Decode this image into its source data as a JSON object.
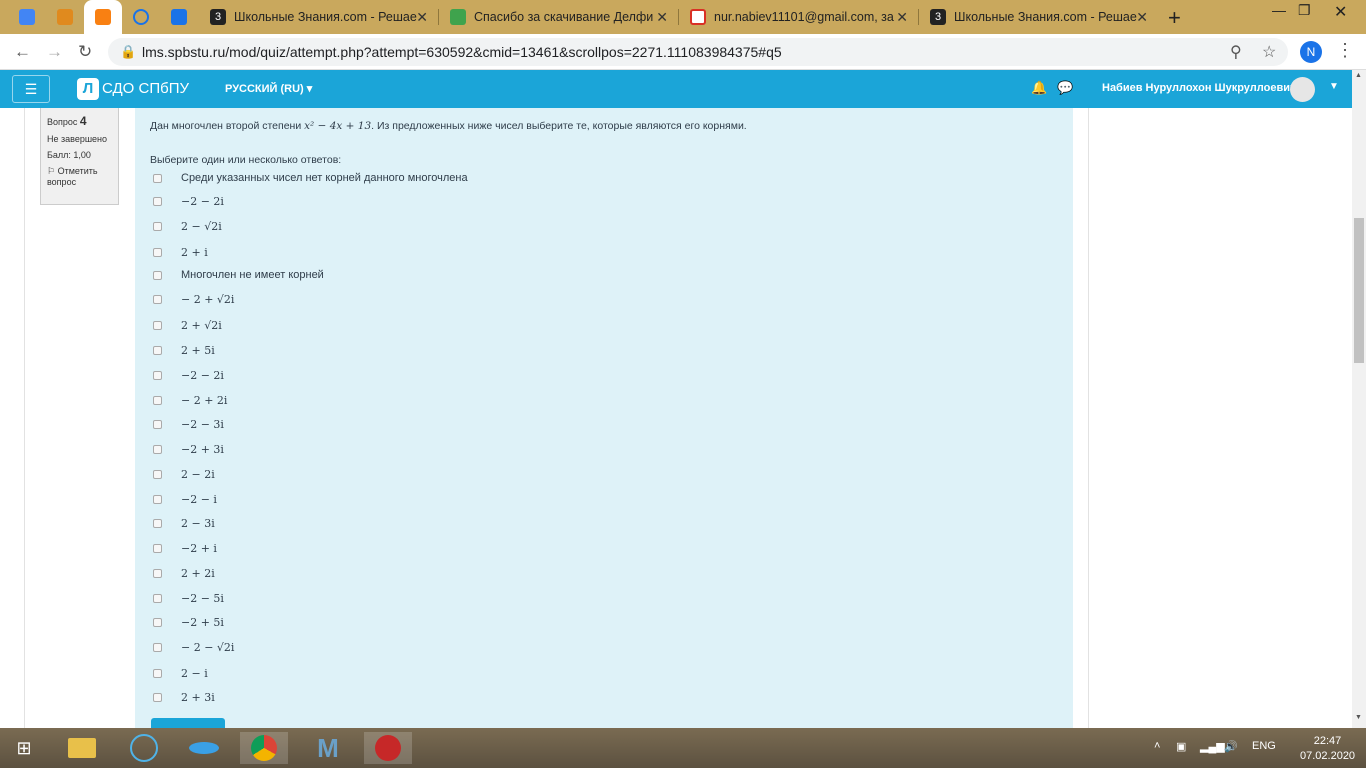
{
  "browser": {
    "tabs": [
      {
        "title": "",
        "icon": "translate-icon",
        "color": "#4285f4"
      },
      {
        "title": "",
        "icon": "graduation-cap-icon",
        "color": "#e08a1e"
      },
      {
        "title": "",
        "icon": "moodle-icon",
        "color": "#f98012"
      },
      {
        "title": "",
        "icon": "loading-icon",
        "color": "#1a73e8"
      },
      {
        "title": "",
        "icon": "chat-icon",
        "color": "#1a73e8"
      },
      {
        "title": "Школьные Знания.com - Решае",
        "icon": "znanija-icon",
        "color": "#222222"
      },
      {
        "title": "Спасибо за скачивание Делфи",
        "icon": "download-icon",
        "color": "#3fa34d"
      },
      {
        "title": "nur.nabiev11101@gmail.com, за",
        "icon": "gmail-icon",
        "color": "#d93025"
      },
      {
        "title": "Школьные Знания.com - Решае",
        "icon": "znanija-icon",
        "color": "#222222"
      }
    ],
    "url": "lms.spbstu.ru/mod/quiz/attempt.php?attempt=630592&cmid=13461&scrollpos=2271.111083984375#q5",
    "profile_initial": "N"
  },
  "navbar": {
    "logo_glyph": "Л",
    "site_name": "СДО СПбПУ",
    "language": "РУССКИЙ (RU)",
    "user_name": "Набиев Нуруллохон Шукруллоевич"
  },
  "question_info": {
    "label": "Вопрос",
    "number": "4",
    "state": "Не завершено",
    "grade": "Балл: 1,00",
    "flag": "Отметить вопрос"
  },
  "question": {
    "text_before": "Дан многочлен второй степени ",
    "polynomial": "x² − 4x + 13",
    "text_after": ". Из предложенных ниже чисел выберите те, которые являются его корнями.",
    "prompt": "Выберите один или несколько ответов:",
    "options": [
      "Среди указанных чисел нет корней данного многочлена",
      "−2 − 2i",
      "2 − √2i",
      "2 + i",
      "Многочлен не имеет корней",
      "− 2 + √2i",
      "2 + √2i",
      "2 + 5i",
      "−2 − 2i",
      "− 2 + 2i",
      "−2 − 3i",
      "−2 + 3i",
      "2 − 2i",
      "−2 − i",
      "2 − 3i",
      "−2 + i",
      "2 + 2i",
      "−2 − 5i",
      "−2 + 5i",
      "− 2 − √2i",
      "2 − i",
      "2 + 3i"
    ]
  },
  "taskbar": {
    "language": "ENG",
    "time": "22:47",
    "date": "07.02.2020"
  }
}
